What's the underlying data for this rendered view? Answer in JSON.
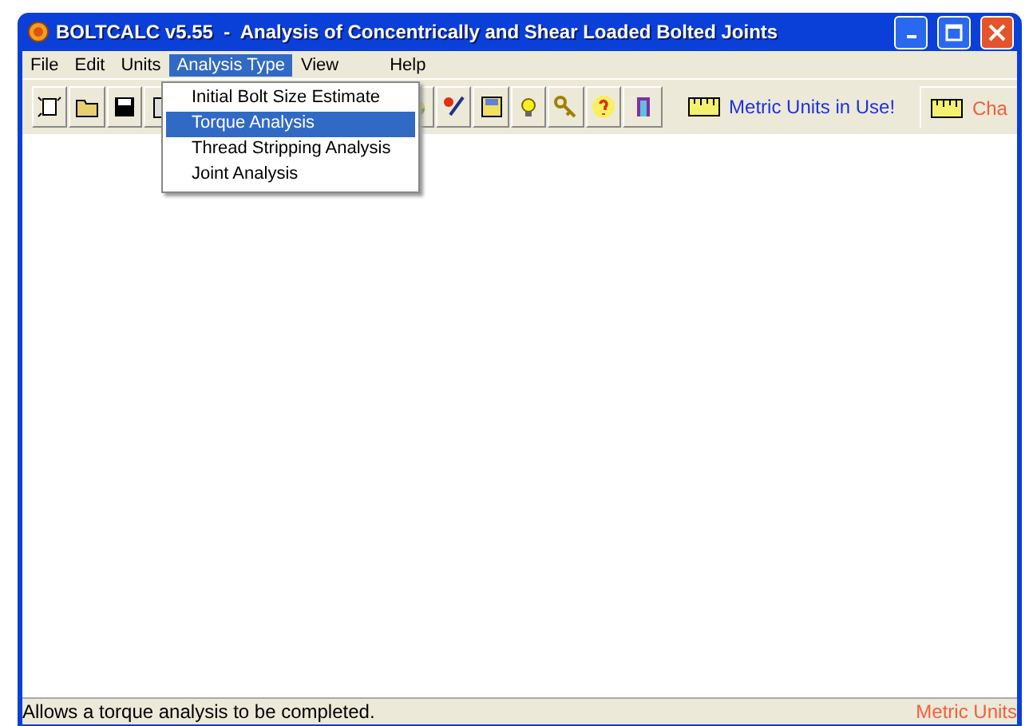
{
  "window": {
    "title": "BOLTCALC v5.55  -  Analysis of Concentrically and Shear Loaded Bolted Joints"
  },
  "menu": [
    {
      "label": "File",
      "selected": false
    },
    {
      "label": "Edit",
      "selected": false
    },
    {
      "label": "Units",
      "selected": false
    },
    {
      "label": "Analysis Type",
      "selected": true
    },
    {
      "label": "View",
      "selected": false
    },
    {
      "label": "Help",
      "selected": false
    }
  ],
  "dropdown": [
    {
      "label": "Initial Bolt Size Estimate",
      "selected": false
    },
    {
      "label": "Torque Analysis",
      "selected": true
    },
    {
      "label": "Thread Stripping Analysis",
      "selected": false
    },
    {
      "label": "Joint Analysis",
      "selected": false
    }
  ],
  "toolbar": {
    "units_button": "Metric Units in Use!",
    "change_button": "Cha"
  },
  "status_bar": {
    "message": "Allows a torque analysis to be completed.",
    "units": "Metric Units"
  }
}
